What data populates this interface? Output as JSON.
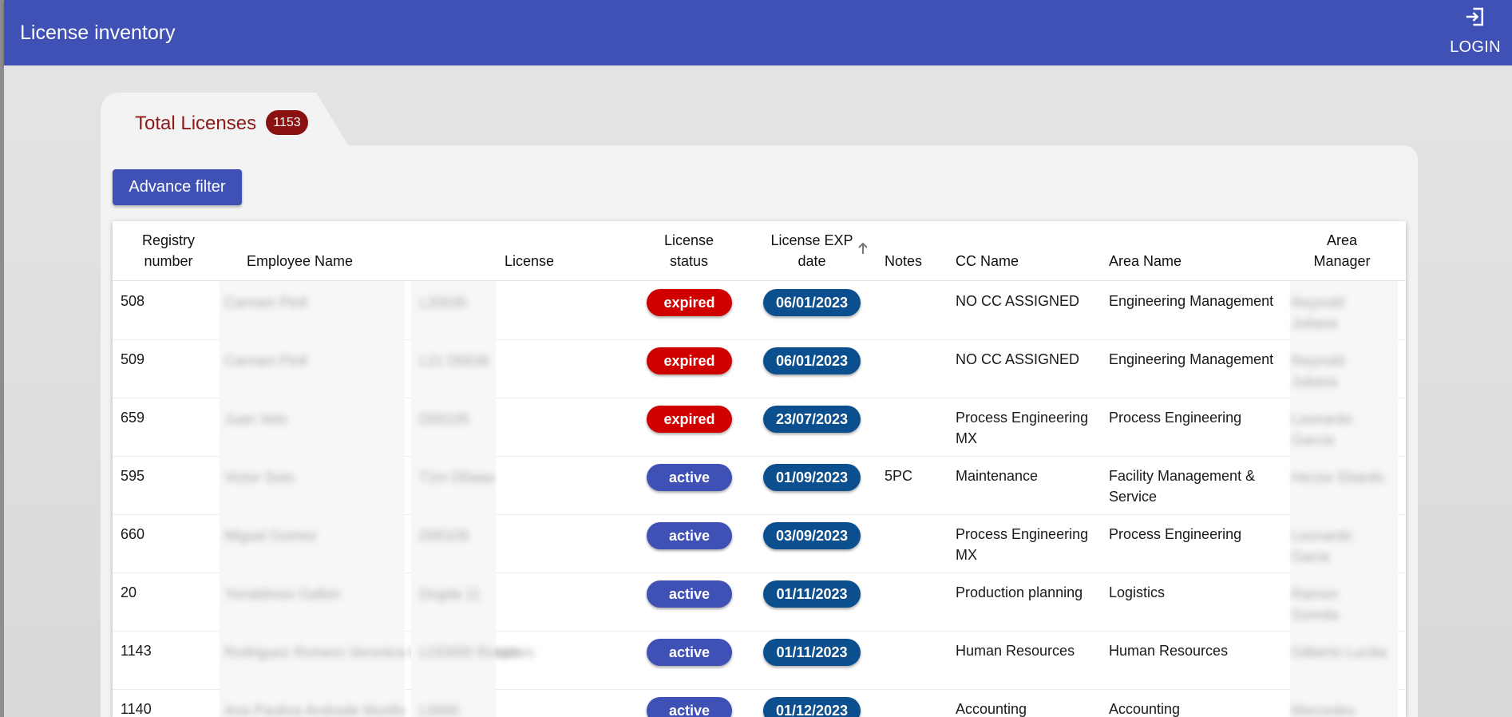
{
  "app": {
    "title": "License inventory",
    "login_label": "LOGIN"
  },
  "summary": {
    "tab_label": "Total Licenses",
    "total_count": "1153"
  },
  "toolbar": {
    "filter_label": "Advance filter"
  },
  "table": {
    "columns": {
      "registry": [
        "Registry",
        "number"
      ],
      "employee": "Employee Name",
      "license": "License",
      "status": [
        "License",
        "status"
      ],
      "exp": [
        "License EXP",
        "date"
      ],
      "notes": "Notes",
      "cc": "CC Name",
      "area": "Area Name",
      "manager": [
        "Area",
        "Manager"
      ]
    },
    "sort": {
      "column": "License EXP date",
      "direction": "ascending"
    },
    "rows": [
      {
        "registry": "508",
        "status": "expired",
        "exp": "06/01/2023",
        "notes": "",
        "cc": "NO CC ASSIGNED",
        "area": "Engineering Management"
      },
      {
        "registry": "509",
        "status": "expired",
        "exp": "06/01/2023",
        "notes": "",
        "cc": "NO CC ASSIGNED",
        "area": "Engineering Management"
      },
      {
        "registry": "659",
        "status": "expired",
        "exp": "23/07/2023",
        "notes": "",
        "cc": "Process Engineering MX",
        "area": "Process Engineering"
      },
      {
        "registry": "595",
        "status": "active",
        "exp": "01/09/2023",
        "notes": "5PC",
        "cc": "Maintenance",
        "area": "Facility Management & Service"
      },
      {
        "registry": "660",
        "status": "active",
        "exp": "03/09/2023",
        "notes": "",
        "cc": "Process Engineering MX",
        "area": "Process Engineering"
      },
      {
        "registry": "20",
        "status": "active",
        "exp": "01/11/2023",
        "notes": "",
        "cc": "Production planning",
        "area": "Logistics"
      },
      {
        "registry": "1143",
        "status": "active",
        "exp": "01/11/2023",
        "notes": "",
        "cc": "Human Resources",
        "area": "Human Resources"
      },
      {
        "registry": "1140",
        "status": "active",
        "exp": "01/12/2023",
        "notes": "",
        "cc": "Accounting",
        "area": "Accounting"
      }
    ]
  },
  "colors": {
    "appbar": "#3f51b5",
    "expired": "#d10000",
    "active": "#3f51b5",
    "date_pill": "#0b4f8f",
    "count_badge": "#8b1111",
    "tab_title": "#8b1a1a"
  },
  "icons": {
    "login": "login-icon",
    "sort": "arrow-up-icon"
  }
}
